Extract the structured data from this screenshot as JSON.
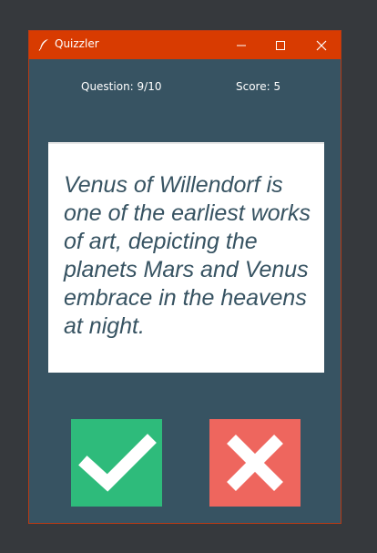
{
  "window": {
    "title": "Quizzler",
    "controls": [
      "minimize-icon",
      "maximize-icon",
      "close-icon"
    ]
  },
  "header": {
    "question_counter": "Question: 9/10",
    "score": "Score: 5"
  },
  "card": {
    "question": "Venus of Willendorf is one of the earliest works of art, depicting the planets Mars and Venus embrace in the heavens at night."
  },
  "answers": {
    "true_icon": "checkmark-icon",
    "false_icon": "x-mark-icon"
  },
  "colors": {
    "titlebar": "#d83b01",
    "background": "#375362",
    "card": "#ffffff",
    "question_text": "#375362",
    "true_button": "#2ebb7b",
    "false_button": "#ee665e"
  }
}
